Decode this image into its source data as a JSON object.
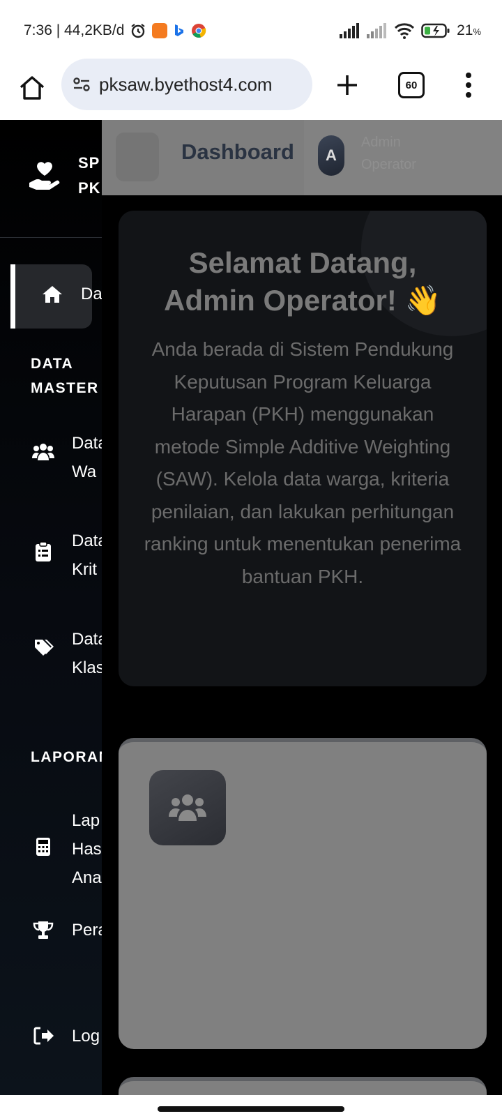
{
  "status_bar": {
    "time_speed": "7:36 | 44,2KB/d",
    "battery": "21",
    "battery_unit": "%",
    "icons": [
      "alarm-icon",
      "app-icon",
      "bing-icon",
      "chrome-icon",
      "signal-icon",
      "signal-icon",
      "wifi-icon",
      "battery-icon"
    ]
  },
  "browser": {
    "url": "pksaw.byethost4.com",
    "tab_count": "60"
  },
  "sidebar": {
    "brand_line1": "SP",
    "brand_line2": "PK",
    "active_item": "Da",
    "section_master_line1": "DATA",
    "section_master_line2": "MASTER",
    "item_warga_line1": "Data",
    "item_warga_line2": "Wa",
    "item_kriteria_line1": "Data",
    "item_kriteria_line2": "Krit",
    "item_klasifikasi_line1": "Data",
    "item_klasifikasi_line2": "Klas",
    "section_laporan": "LAPORAN",
    "item_laporan_line1": "Lap",
    "item_laporan_line2": "Has",
    "item_laporan_line3": "Ana",
    "item_peringkat": "Pera",
    "item_logout": "Log"
  },
  "topbar": {
    "title": "Dashboard",
    "avatar_initial": "A",
    "user_line1": "Admin",
    "user_line2": "Operator"
  },
  "welcome": {
    "heading_line1": "Selamat Datang,",
    "heading_line2": "Admin Operator! 👋",
    "text": "Anda berada di Sistem Pendukung Keputusan Program Keluarga Harapan (PKH) menggunakan metode Simple Additive Weighting (SAW). Kelola data warga, kriteria penilaian, dan lakukan perhitungan ranking untuk menentukan penerima bantuan PKH."
  },
  "colors": {
    "sidebar_bg": "#000000",
    "overlay_gray": "#808080",
    "active_bg": "#26282c"
  }
}
